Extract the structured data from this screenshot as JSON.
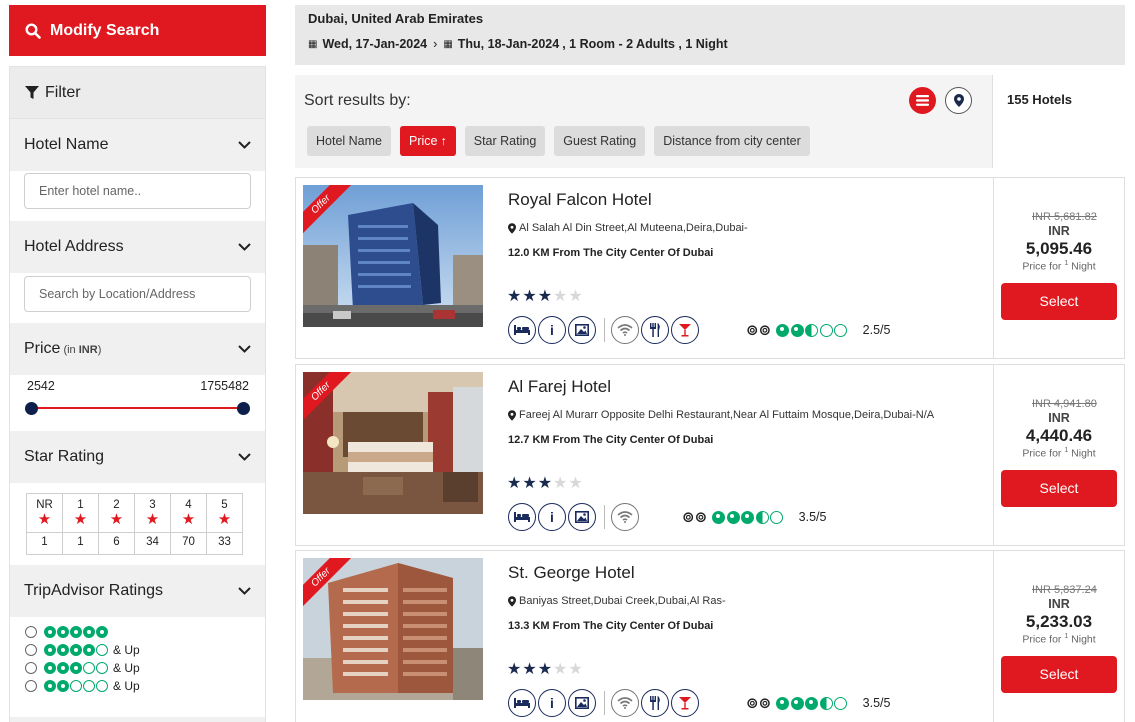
{
  "left": {
    "modify_label": "Modify Search",
    "filter_label": "Filter",
    "hotel_name": {
      "title": "Hotel Name",
      "placeholder": "Enter hotel name.."
    },
    "hotel_address": {
      "title": "Hotel Address",
      "placeholder": "Search by Location/Address"
    },
    "price": {
      "title": "Price",
      "unit_prefix": "(in ",
      "unit": "INR",
      "unit_suffix": ")",
      "min": "2542",
      "max": "1755482"
    },
    "star_rating": {
      "title": "Star Rating",
      "cells": [
        {
          "label": "NR",
          "count": "1"
        },
        {
          "label": "1",
          "count": "1"
        },
        {
          "label": "2",
          "count": "6"
        },
        {
          "label": "3",
          "count": "34"
        },
        {
          "label": "4",
          "count": "70"
        },
        {
          "label": "5",
          "count": "33"
        }
      ]
    },
    "tripadvisor": {
      "title": "TripAdvisor Ratings",
      "options": [
        {
          "filled": 5,
          "suffix": ""
        },
        {
          "filled": 4,
          "suffix": "& Up"
        },
        {
          "filled": 3,
          "suffix": "& Up"
        },
        {
          "filled": 2,
          "suffix": "& Up"
        }
      ]
    }
  },
  "search": {
    "destination": "Dubai, United Arab Emirates",
    "checkin": "Wed, 17-Jan-2024",
    "checkout": "Thu, 18-Jan-2024",
    "summary": ", 1 Room - 2 Adults , 1 Night"
  },
  "sort": {
    "label": "Sort results by:",
    "options": [
      "Hotel Name",
      "Price",
      "Star Rating",
      "Guest Rating",
      "Distance from city center"
    ],
    "active_arrow": "↑",
    "hotel_count": "155 Hotels"
  },
  "hotels": [
    {
      "ribbon": "Offer",
      "name": "Royal Falcon Hotel",
      "address": "Al Salah Al Din Street,Al Muteena,Deira,Dubai-",
      "distance": "12.0 KM From The City Center Of Dubai",
      "stars": 3,
      "ta_rating": "2.5/5",
      "old_price": "INR 5,681.82",
      "currency": "INR",
      "price": "5,095.46",
      "per_prefix": "Price for",
      "per_num": "1",
      "per_suffix": "Night",
      "select_label": "Select"
    },
    {
      "ribbon": "Offer",
      "name": "Al Farej Hotel",
      "address": "Fareej Al Murarr Opposite Delhi Restaurant,Near Al Futtaim Mosque,Deira,Dubai-N/A",
      "distance": "12.7 KM From The City Center Of Dubai",
      "stars": 3,
      "ta_rating": "3.5/5",
      "old_price": "INR 4,941.80",
      "currency": "INR",
      "price": "4,440.46",
      "per_prefix": "Price for",
      "per_num": "1",
      "per_suffix": "Night",
      "select_label": "Select"
    },
    {
      "ribbon": "Offer",
      "name": "St. George Hotel",
      "address": "Baniyas Street,Dubai Creek,Dubai,Al Ras-",
      "distance": "13.3 KM From The City Center Of Dubai",
      "stars": 3,
      "ta_rating": "3.5/5",
      "old_price": "INR 5,837.24",
      "currency": "INR",
      "price": "5,233.03",
      "per_prefix": "Price for",
      "per_num": "1",
      "per_suffix": "Night",
      "select_label": "Select"
    }
  ],
  "colors": {
    "accent": "#e0181f",
    "navy": "#1a2a5c",
    "tripadvisor": "#00aa6c"
  }
}
